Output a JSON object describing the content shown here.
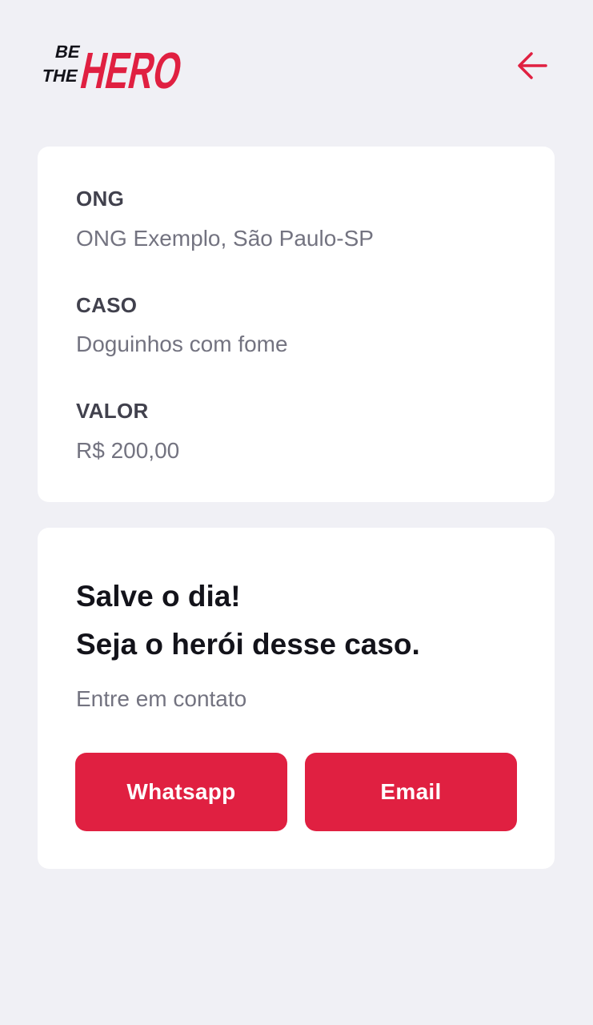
{
  "header": {
    "logo": {
      "line1": "BE",
      "line2": "THE",
      "word": "HERO"
    },
    "back_icon": "arrow-left-icon"
  },
  "incident": {
    "ong_label": "ONG",
    "ong_value": "ONG Exemplo, São Paulo-SP",
    "case_label": "CASO",
    "case_value": "Doguinhos com fome",
    "value_label": "VALOR",
    "value_value": "R$ 200,00"
  },
  "contact": {
    "title_line1": "Salve o dia!",
    "title_line2": "Seja o herói desse caso.",
    "description": "Entre em contato",
    "whatsapp_label": "Whatsapp",
    "email_label": "Email"
  },
  "colors": {
    "background": "#f0f0f5",
    "card": "#ffffff",
    "accent": "#e02041",
    "label": "#41414d",
    "value": "#737380",
    "title": "#13131a"
  }
}
